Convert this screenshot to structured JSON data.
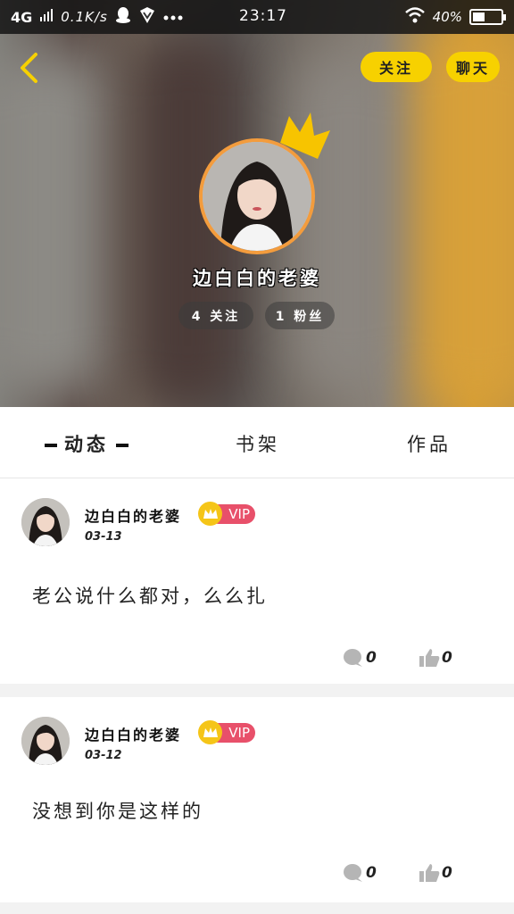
{
  "status_bar": {
    "network": "4G",
    "speed": "0.1K/s",
    "time": "23:17",
    "battery": "40%"
  },
  "profile": {
    "name": "边白白的老婆",
    "follow_button": "关注",
    "chat_button": "聊天",
    "following_stat": "4 关注",
    "fans_stat": "1 粉丝"
  },
  "tabs": {
    "active": "动态",
    "shelf": "书架",
    "works": "作品"
  },
  "posts": [
    {
      "author": "边白白的老婆",
      "vip": "VIP",
      "date": "03-13",
      "text": "老公说什么都对，么么扎",
      "comments": "0",
      "likes": "0"
    },
    {
      "author": "边白白的老婆",
      "vip": "VIP",
      "date": "03-12",
      "text": "没想到你是这样的",
      "comments": "0",
      "likes": "0"
    }
  ],
  "colors": {
    "accent_yellow": "#f7d100",
    "avatar_ring": "#f39c3d",
    "vip_pink": "#e8506a"
  }
}
